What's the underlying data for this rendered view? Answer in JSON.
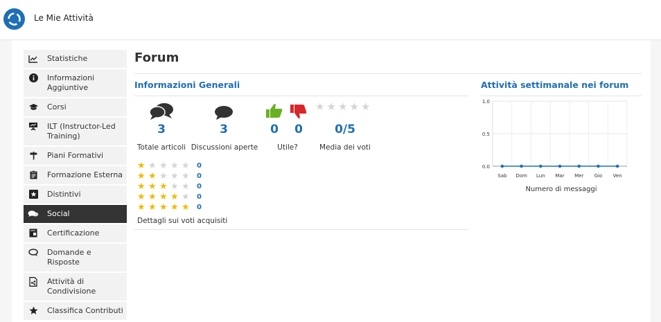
{
  "header": {
    "title": "Le Mie Attività",
    "logo_icon": "circular-logo-icon"
  },
  "sidebar": {
    "items": [
      {
        "label": "Statistiche",
        "icon": "line-chart-icon",
        "active": false
      },
      {
        "label": "Informazioni Aggiuntive",
        "icon": "info-icon",
        "active": false
      },
      {
        "label": "Corsi",
        "icon": "graduation-cap-icon",
        "active": false
      },
      {
        "label": "ILT (Instructor-Led Training)",
        "icon": "presentation-board-icon",
        "active": false
      },
      {
        "label": "Piani Formativi",
        "icon": "signpost-icon",
        "active": false
      },
      {
        "label": "Formazione Esterna",
        "icon": "clipboard-icon",
        "active": false
      },
      {
        "label": "Distintivi",
        "icon": "star-badge-icon",
        "active": false
      },
      {
        "label": "Social",
        "icon": "chat-bubbles-icon",
        "active": true
      },
      {
        "label": "Certificazione",
        "icon": "certificate-book-icon",
        "active": false
      },
      {
        "label": "Domande e Risposte",
        "icon": "question-bubble-icon",
        "active": false
      },
      {
        "label": "Attività di Condivisione",
        "icon": "share-document-icon",
        "active": false
      },
      {
        "label": "Classifica Contributi",
        "icon": "star-icon",
        "active": false
      }
    ]
  },
  "main": {
    "title": "Forum",
    "general": {
      "title": "Informazioni Generali",
      "total_posts": {
        "value": "3",
        "label": "Totale articoli"
      },
      "open_discussions": {
        "value": "3",
        "label": "Discussioni aperte"
      },
      "useful": {
        "up": "0",
        "down": "0",
        "label": "Utile?"
      },
      "avg_rating": {
        "value": "0/5",
        "label": "Media dei voti",
        "stars_filled": 0,
        "stars_total": 5
      },
      "rating_breakdown": [
        {
          "stars": 1,
          "count": "0"
        },
        {
          "stars": 2,
          "count": "0"
        },
        {
          "stars": 3,
          "count": "0"
        },
        {
          "stars": 4,
          "count": "0"
        },
        {
          "stars": 5,
          "count": "0"
        }
      ],
      "details_label": "Dettagli sui voti acquisiti"
    },
    "weekly": {
      "title": "Attività settimanale nei forum",
      "chart_data": {
        "type": "line",
        "categories": [
          "Sab",
          "Dom",
          "Lun",
          "Mar",
          "Mer",
          "Gio",
          "Ven"
        ],
        "values": [
          0,
          0,
          0,
          0,
          0,
          0,
          0
        ],
        "yticks": [
          "0.0",
          "0.5",
          "1.0"
        ],
        "ylim": [
          0,
          1
        ],
        "xlabel": "Numero di messaggi",
        "grid": true,
        "series_color": "#1e6fb6"
      }
    }
  },
  "colors": {
    "accent": "#1e6fb6",
    "thumb_up": "#6ab023",
    "thumb_down": "#d9262a",
    "star": "#f5b800"
  }
}
